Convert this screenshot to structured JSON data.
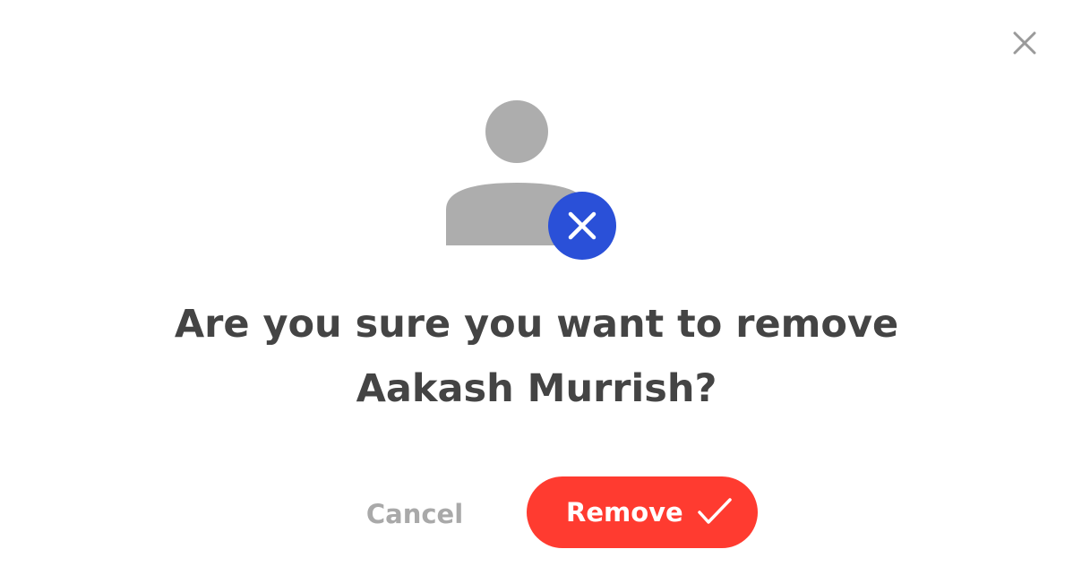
{
  "dialog": {
    "title": "Are you sure you want to remove Aakash Murrish?",
    "cancel_label": "Cancel",
    "remove_label": "Remove"
  },
  "icons": {
    "close": "close-icon",
    "avatar": "user-avatar-icon",
    "badge": "remove-x-icon",
    "confirm": "checkmark-icon"
  },
  "colors": {
    "accent_blue": "#2a50d8",
    "danger_red": "#ff3b30",
    "avatar_gray": "#adadad",
    "title_text": "#444444",
    "cancel_text": "#a9a9a9",
    "close_icon": "#9a9a9a"
  }
}
